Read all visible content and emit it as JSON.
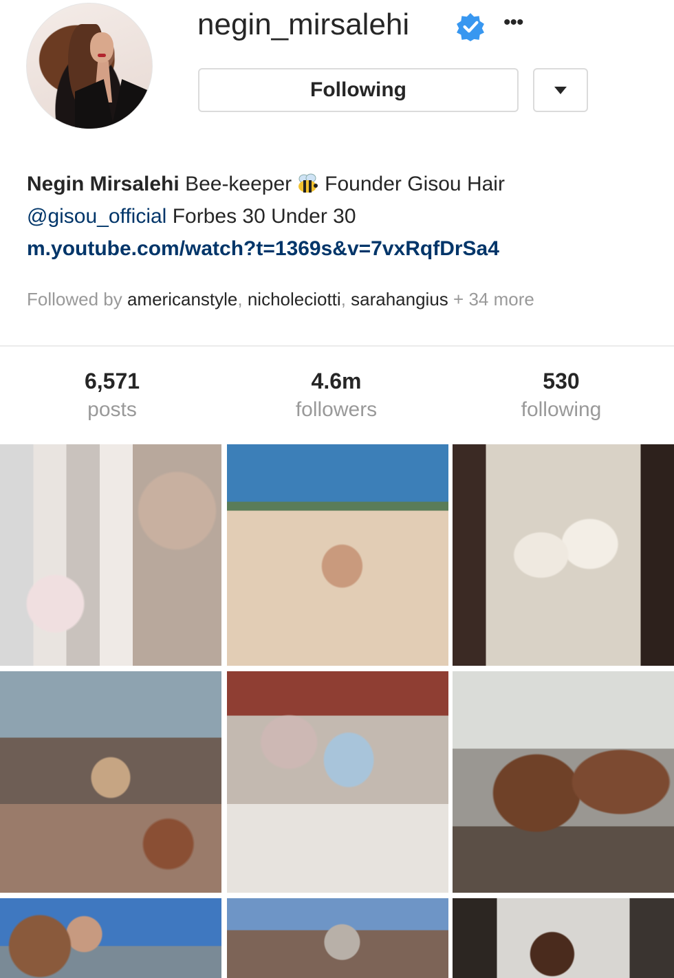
{
  "profile": {
    "username": "negin_mirsalehi",
    "verified_icon": "verified-badge-icon",
    "more_label": "•••",
    "following_label": "Following",
    "dropdown_icon": "caret-down-icon",
    "avatar_alt": "profile-avatar"
  },
  "bio": {
    "name": "Negin Mirsalehi",
    "text1": "Bee-keeper",
    "emoji": "bee-emoji",
    "text2": "Founder Gisou Hair",
    "mention": "@gisou_official",
    "text3": "Forbes 30 Under 30",
    "link": "m.youtube.com/watch?t=1369s&v=7vxRqfDrSa4"
  },
  "followed_by": {
    "prefix": "Followed by",
    "users": [
      "americanstyle",
      "nicholeciotti",
      "sarahangius"
    ],
    "suffix": "+ 34 more"
  },
  "stats": [
    {
      "value": "6,571",
      "label": "posts"
    },
    {
      "value": "4.6m",
      "label": "followers"
    },
    {
      "value": "530",
      "label": "following"
    }
  ],
  "colors": {
    "link": "#003569",
    "verified": "#3897f0",
    "muted": "#999999",
    "text": "#262626"
  }
}
